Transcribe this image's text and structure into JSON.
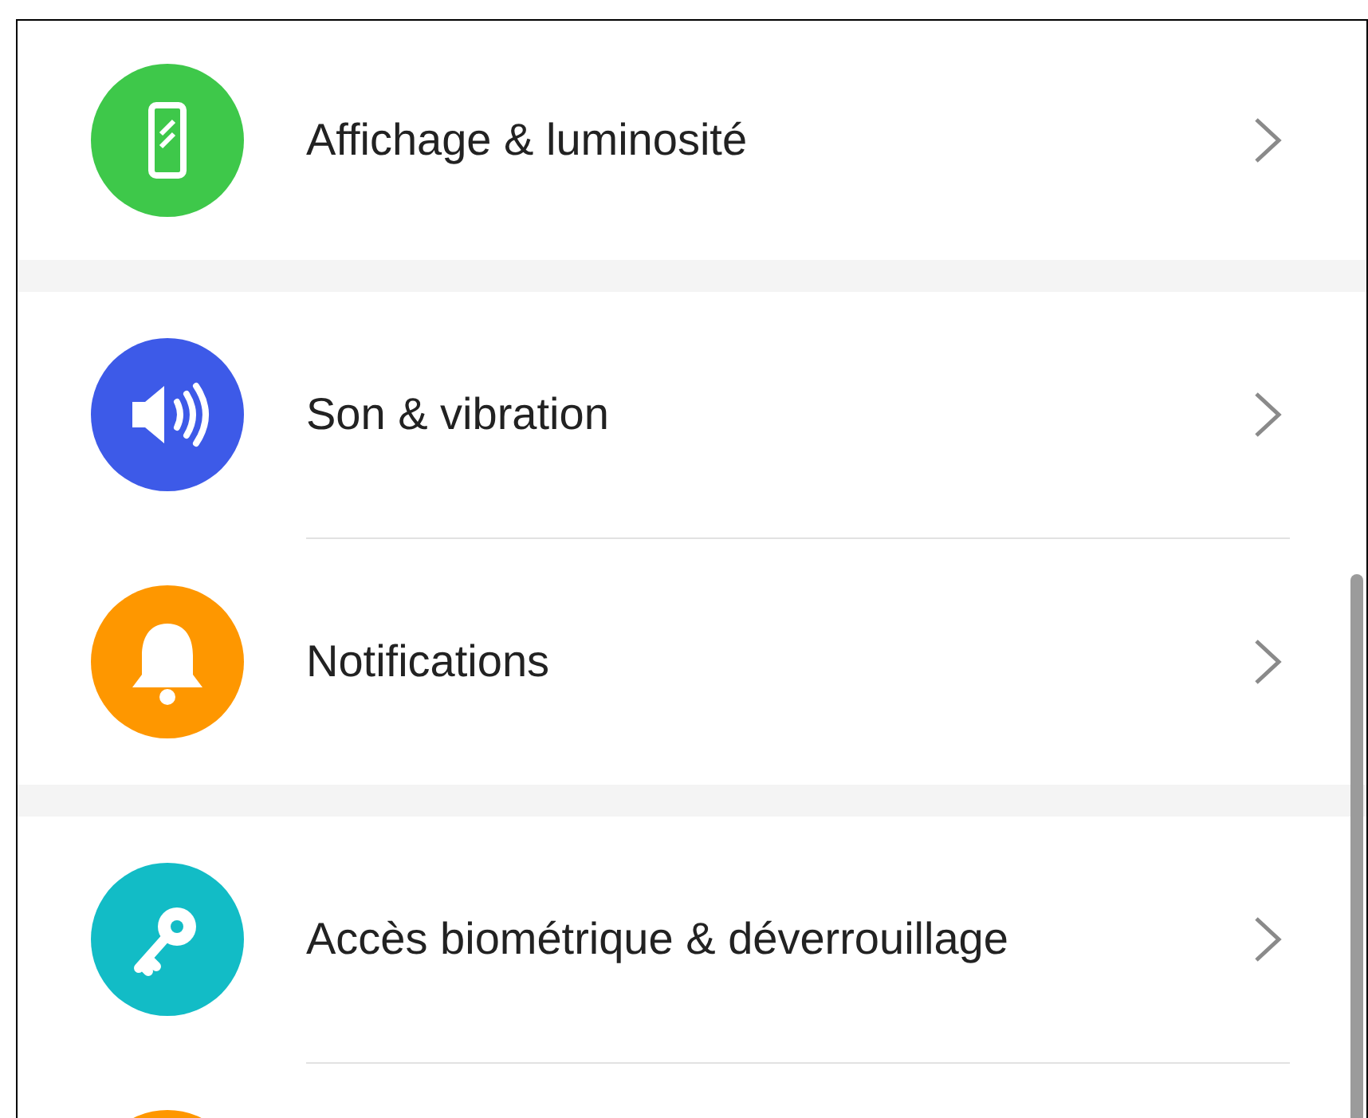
{
  "groups": [
    {
      "items": [
        {
          "kind": "display",
          "color": "#3ec84a",
          "label": "Affichage & luminosité"
        }
      ]
    },
    {
      "items": [
        {
          "kind": "sound",
          "color": "#3d5ae8",
          "label": "Son & vibration"
        },
        {
          "kind": "bell",
          "color": "#fe9700",
          "label": "Notifications"
        }
      ]
    },
    {
      "items": [
        {
          "kind": "key",
          "color": "#12bcc6",
          "label": "Accès biométrique & déverrouillage"
        },
        {
          "kind": "blank",
          "color": "#fe9700"
        }
      ]
    }
  ]
}
